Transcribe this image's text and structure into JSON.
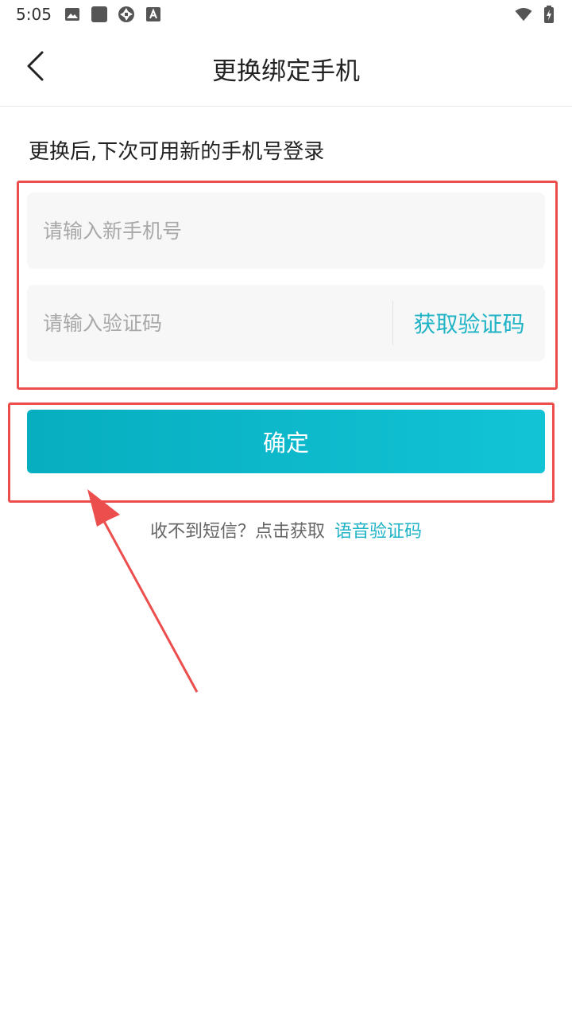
{
  "status_bar": {
    "time": "5:05",
    "left_icons": [
      "image-icon",
      "square-icon",
      "aperture-icon",
      "font-a-icon"
    ],
    "right_icons": [
      "wifi-icon",
      "battery-icon"
    ]
  },
  "header": {
    "title": "更换绑定手机",
    "back_icon": "chevron-left-icon"
  },
  "form": {
    "hint": "更换后,下次可用新的手机号登录",
    "phone_placeholder": "请输入新手机号",
    "phone_value": "",
    "code_placeholder": "请输入验证码",
    "code_value": "",
    "get_code_label": "获取验证码",
    "confirm_label": "确定"
  },
  "sms": {
    "prompt": "收不到短信？点击获取",
    "voice_link": "语音验证码"
  },
  "colors": {
    "accent": "#1fb3c6",
    "button_start": "#07aebf",
    "button_end": "#12c3d6",
    "annotation": "#ec4d4d"
  }
}
